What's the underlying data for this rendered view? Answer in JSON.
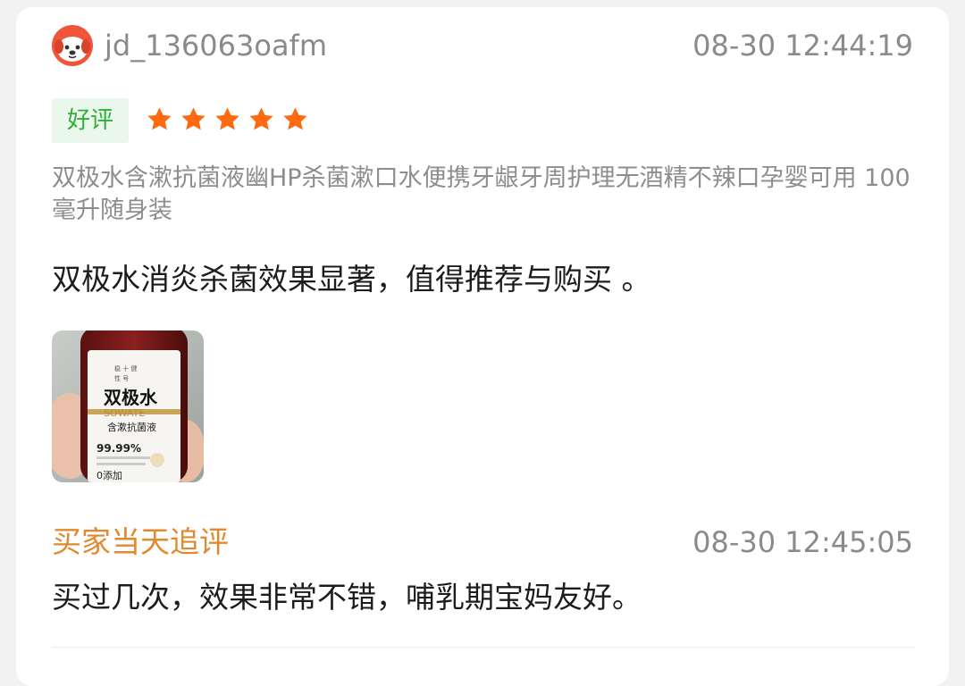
{
  "review": {
    "username": "jd_136063oafm",
    "time": "08-30 12:44:19",
    "badge": "好评",
    "rating": 5,
    "product_title": "双极水含漱抗菌液幽HP杀菌漱口水便携牙龈牙周护理无酒精不辣口孕婴可用 100毫升随身装",
    "comment": "双极水消炎杀菌效果显著，值得推荐与购买 。",
    "photo": {
      "pre_lines": [
        "稳 十 健",
        "性 号"
      ],
      "brand": "双极水",
      "brand_en": "SOWATE",
      "subtitle": "含漱抗菌液",
      "percent": "99.99%",
      "zero_add": "0添加"
    }
  },
  "follow_up": {
    "label": "买家当天追评",
    "time": "08-30 12:45:05",
    "comment": "买过几次，效果非常不错，哺乳期宝妈友好。"
  },
  "colors": {
    "star": "#ff6a10",
    "badge_text": "#2fae3a",
    "badge_bg": "#e9f7ec",
    "follow_label": "#e2892e",
    "avatar": "#f0553a"
  },
  "icons": {
    "avatar": "jd-dog-avatar-icon",
    "star": "star-icon"
  }
}
